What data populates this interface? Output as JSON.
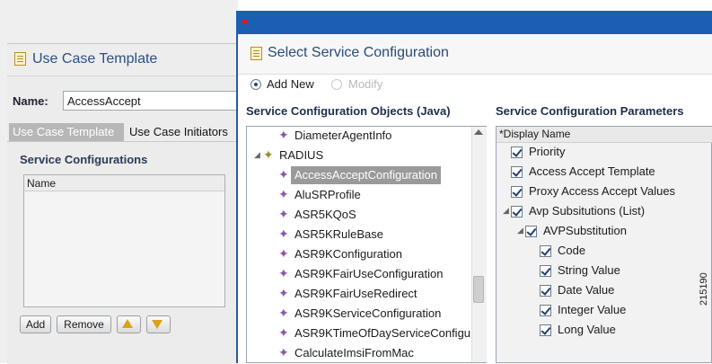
{
  "bg_window": {
    "title": "Use Case Template",
    "name_label": "Name:",
    "name_value": "AccessAccept",
    "tabs": [
      "Use Case Template",
      "Use Case Initiators"
    ],
    "section_title": "Service Configurations",
    "list_header": "Name",
    "buttons": {
      "add": "Add",
      "remove": "Remove"
    }
  },
  "dialog": {
    "title": "Select Service Configuration",
    "radio_add": "Add New",
    "radio_modify": "Modify",
    "left_heading": "Service Configuration Objects (Java)",
    "right_heading": "Service Configuration Parameters",
    "tree": [
      {
        "label": "DiameterAgentInfo"
      },
      {
        "label": "RADIUS"
      },
      {
        "label": "AccessAcceptConfiguration"
      },
      {
        "label": "AluSRProfile"
      },
      {
        "label": "ASR5KQoS"
      },
      {
        "label": "ASR5KRuleBase"
      },
      {
        "label": "ASR9KConfiguration"
      },
      {
        "label": "ASR9KFairUseConfiguration"
      },
      {
        "label": "ASR9KFairUseRedirect"
      },
      {
        "label": "ASR9KServiceConfiguration"
      },
      {
        "label": "ASR9KTimeOfDayServiceConfigu"
      },
      {
        "label": "CalculateImsiFromMac"
      }
    ],
    "params_header": "*Display Name",
    "params": [
      {
        "label": "Priority"
      },
      {
        "label": "Access Accept Template"
      },
      {
        "label": "Proxy Access Accept Values"
      },
      {
        "label": "Avp Subsitutions (List)"
      },
      {
        "label": "AVPSubstitution"
      },
      {
        "label": "Code"
      },
      {
        "label": "String Value"
      },
      {
        "label": "Date Value"
      },
      {
        "label": "Integer Value"
      },
      {
        "label": "Long Value"
      }
    ]
  },
  "figure_id": "215190"
}
